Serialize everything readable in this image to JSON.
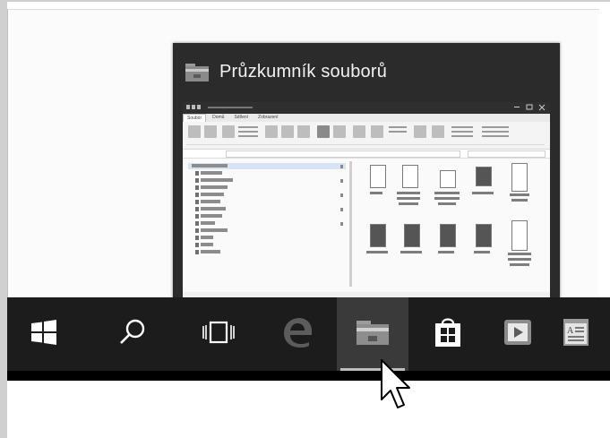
{
  "thumbnail": {
    "title": "Průzkumník souborů",
    "app_icon": "folder-icon"
  },
  "mini_window": {
    "tabs": [
      "Soubor",
      "Domů",
      "Sdílení",
      "Zobrazení"
    ]
  },
  "taskbar": {
    "items": [
      {
        "name": "start",
        "icon": "windows-logo-icon"
      },
      {
        "name": "search",
        "icon": "search-icon"
      },
      {
        "name": "task-view",
        "icon": "task-view-icon"
      },
      {
        "name": "edge",
        "icon": "edge-icon"
      },
      {
        "name": "file-explorer",
        "icon": "folder-icon",
        "active": true
      },
      {
        "name": "store",
        "icon": "store-icon"
      },
      {
        "name": "media",
        "icon": "play-icon"
      },
      {
        "name": "notes",
        "icon": "document-icon"
      }
    ]
  },
  "colors": {
    "taskbar": "#1c1c1c",
    "taskbar_active": "#3a3a3a",
    "preview_bg": "#2b2b2b",
    "preview_title": "#f2f2f2"
  }
}
